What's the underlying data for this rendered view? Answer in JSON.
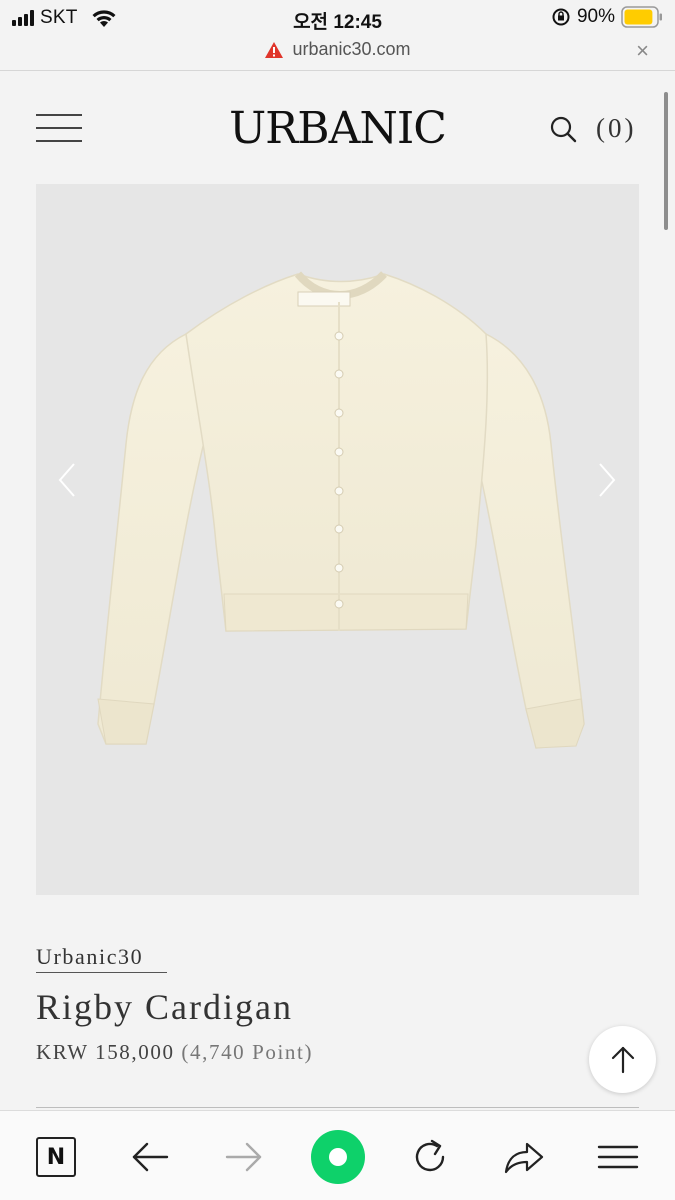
{
  "status_bar": {
    "carrier": "SKT",
    "time": "오전 12:45",
    "battery": "90%",
    "battery_level": 0.9
  },
  "browser": {
    "url": "urbanic30.com",
    "close_label": "×"
  },
  "header": {
    "logo": "URBANIC",
    "cart_count": "(0)"
  },
  "product": {
    "brand": "Urbanic30",
    "name": "Rigby Cardigan",
    "price": "KRW 158,000",
    "points": "(4,740 Point)"
  },
  "colors": {
    "accent_green": "#0ed16a",
    "warning_red": "#e0352b",
    "battery_yellow": "#ffcc00"
  },
  "icons": {
    "menu": "hamburger-icon",
    "search": "search-icon",
    "prev": "chevron-left-icon",
    "next": "chevron-right-icon",
    "scroll_top": "arrow-up-icon",
    "bottom_bar": [
      "naver-home-icon",
      "back-arrow-icon",
      "forward-arrow-icon",
      "green-circle-icon",
      "reload-icon",
      "share-icon",
      "menu-icon"
    ]
  }
}
